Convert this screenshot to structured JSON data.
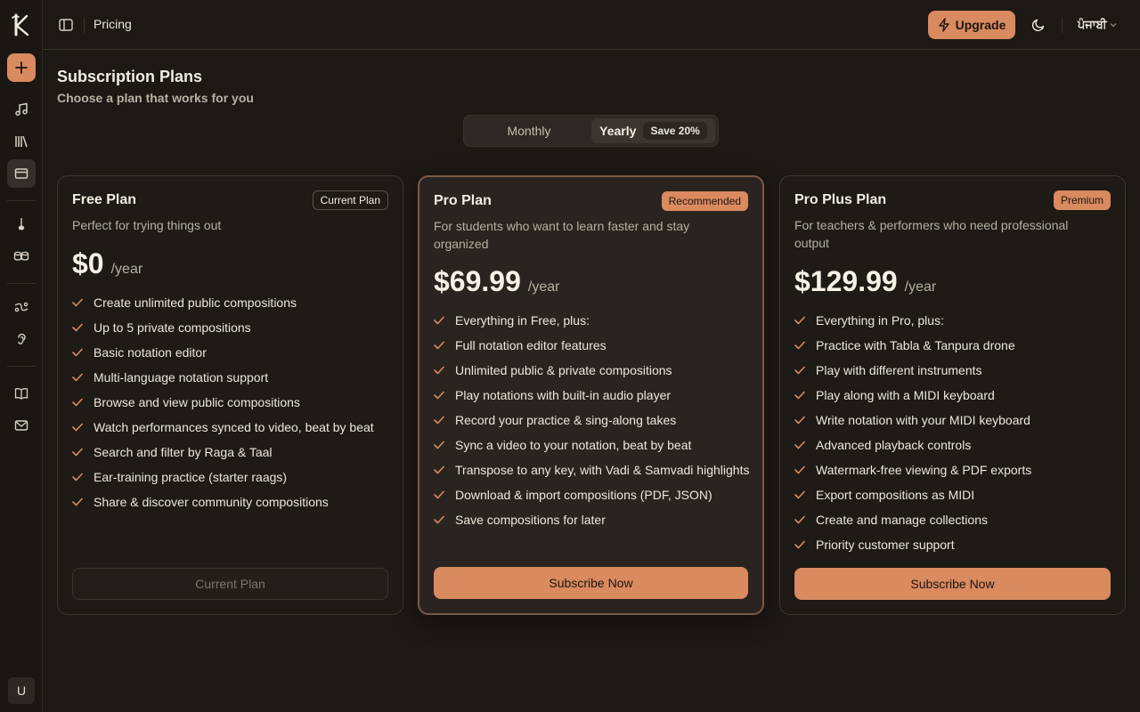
{
  "header": {
    "title": "Pricing",
    "upgrade_label": "Upgrade",
    "language_label": "ਪੰਜਾਬੀ"
  },
  "sidebar": {
    "avatar_letter": "U",
    "icons": [
      "music-note-icon",
      "library-icon",
      "credit-card-icon",
      "sitar-icon",
      "tabla-icon",
      "curve-icon",
      "ear-icon",
      "book-icon",
      "mail-icon"
    ]
  },
  "page": {
    "title": "Subscription Plans",
    "subtitle": "Choose a plan that works for you"
  },
  "billing": {
    "monthly": "Monthly",
    "yearly": "Yearly",
    "save": "Save 20%",
    "selected": "Yearly"
  },
  "plans": [
    {
      "title": "Free Plan",
      "badge": "Current Plan",
      "description": "Perfect for trying things out",
      "price": "$0",
      "period": "/year",
      "features": [
        "Create unlimited public compositions",
        "Up to 5 private compositions",
        "Basic notation editor",
        "Multi-language notation support",
        "Browse and view public compositions",
        "Watch performances synced to video, beat by beat",
        "Search and filter by Raga & Taal",
        "Ear-training practice (starter raags)",
        "Share & discover community compositions"
      ],
      "button": "Current Plan"
    },
    {
      "title": "Pro Plan",
      "badge": "Recommended",
      "description": "For students who want to learn faster and stay organized",
      "price": "$69.99",
      "period": "/year",
      "features": [
        "Everything in Free, plus:",
        "Full notation editor features",
        "Unlimited public & private compositions",
        "Play notations with built-in audio player",
        "Record your practice & sing-along takes",
        "Sync a video to your notation, beat by beat",
        "Transpose to any key, with Vadi & Samvadi highlights",
        "Download & import compositions (PDF, JSON)",
        "Save compositions for later"
      ],
      "button": "Subscribe Now"
    },
    {
      "title": "Pro Plus Plan",
      "badge": "Premium",
      "description": "For teachers & performers who need professional output",
      "price": "$129.99",
      "period": "/year",
      "features": [
        "Everything in Pro, plus:",
        "Practice with Tabla & Tanpura drone",
        "Play with different instruments",
        "Play along with a MIDI keyboard",
        "Write notation with your MIDI keyboard",
        "Advanced playback controls",
        "Watermark-free viewing & PDF exports",
        "Export compositions as MIDI",
        "Create and manage collections",
        "Priority customer support"
      ],
      "button": "Subscribe Now"
    }
  ],
  "colors": {
    "accent": "#d98a5f",
    "background": "#1c1814"
  }
}
